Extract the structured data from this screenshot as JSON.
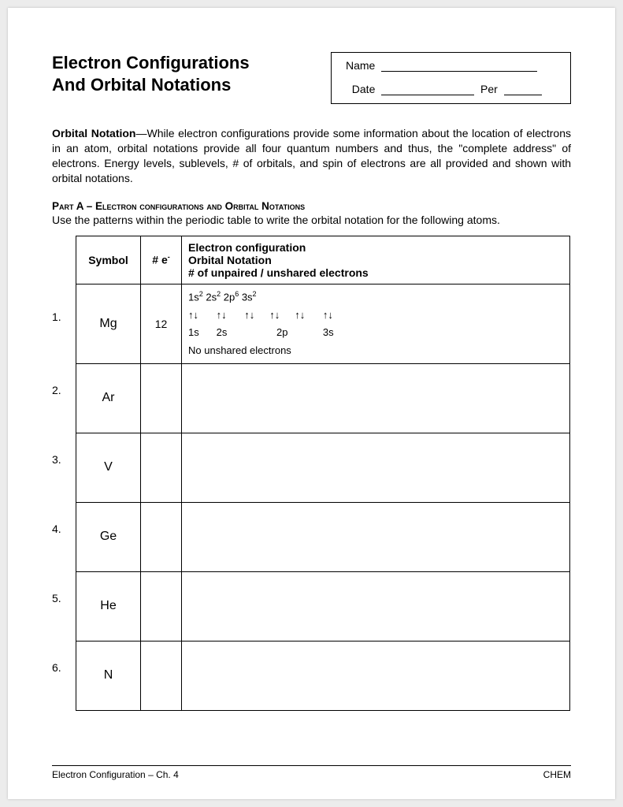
{
  "title_line1": "Electron Configurations",
  "title_line2": "And Orbital Notations",
  "name_label": "Name",
  "date_label": "Date",
  "per_label": "Per",
  "intro_lead": "Orbital Notation",
  "intro_body": "—While electron configurations provide some information about the location of electrons in an atom, orbital notations provide all four quantum numbers and thus, the \"complete address\" of electrons.  Energy levels, sublevels, # of orbitals, and spin of electrons are all provided and shown with orbital notations.",
  "partA_prefix": "Part A – ",
  "partA_caps": "Electron configurations and Orbital Notations",
  "partA_instr": "Use the patterns within the periodic table to write the orbital notation for the following atoms.",
  "col_symbol": "Symbol",
  "col_e_1": "# e",
  "col_e_sup": "-",
  "col3_l1": "Electron configuration",
  "col3_l2": "Orbital Notation",
  "col3_l3": "# of unpaired / unshared electrons",
  "rows": [
    {
      "num": "1.",
      "symbol": "Mg",
      "e": "12"
    },
    {
      "num": "2.",
      "symbol": "Ar",
      "e": ""
    },
    {
      "num": "3.",
      "symbol": "V",
      "e": ""
    },
    {
      "num": "4.",
      "symbol": "Ge",
      "e": ""
    },
    {
      "num": "5.",
      "symbol": "He",
      "e": ""
    },
    {
      "num": "6.",
      "symbol": "N",
      "e": ""
    }
  ],
  "mg_config": "1s",
  "mg_config2": " 2s",
  "mg_config3": " 2p",
  "mg_config4": " 3s",
  "sup2": "2",
  "sup6": "6",
  "arrow_pair": "↑↓",
  "orb_1s": "1s",
  "orb_2s": "2s",
  "orb_2p": "2p",
  "orb_3s": "3s",
  "mg_unshared": "No unshared electrons",
  "footer_left": "Electron Configuration – Ch. 4",
  "footer_right": "CHEM"
}
